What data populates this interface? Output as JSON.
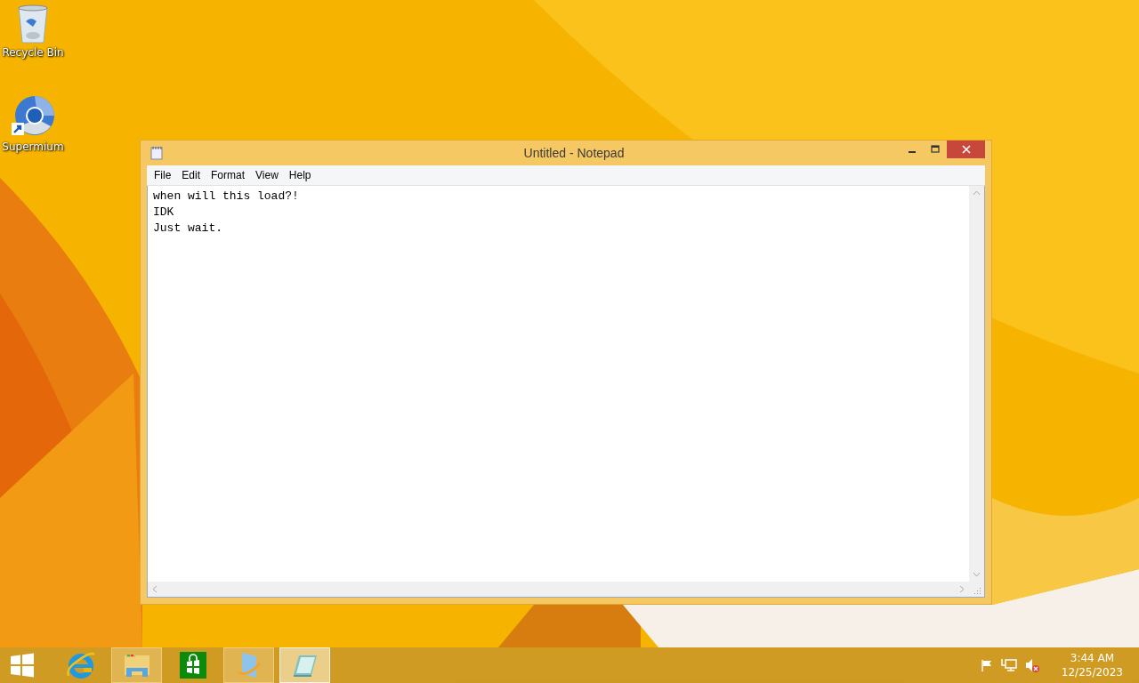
{
  "desktop_icons": [
    {
      "kind": "recycle-bin",
      "label": "Recycle Bin"
    },
    {
      "kind": "browser",
      "label": "Supermium"
    }
  ],
  "window": {
    "title": "Untitled - Notepad",
    "menu": [
      "File",
      "Edit",
      "Format",
      "View",
      "Help"
    ],
    "text": "when will this load?!\nIDK\nJust wait."
  },
  "taskbar": {
    "items": [
      {
        "kind": "start",
        "running": false,
        "active": false
      },
      {
        "kind": "ie",
        "running": false,
        "active": false
      },
      {
        "kind": "explorer",
        "running": true,
        "active": false
      },
      {
        "kind": "store",
        "running": false,
        "active": false
      },
      {
        "kind": "app",
        "running": true,
        "active": false
      },
      {
        "kind": "notepad",
        "running": true,
        "active": true
      }
    ],
    "clock": {
      "time": "3:44 AM",
      "date": "12/25/2023"
    }
  }
}
